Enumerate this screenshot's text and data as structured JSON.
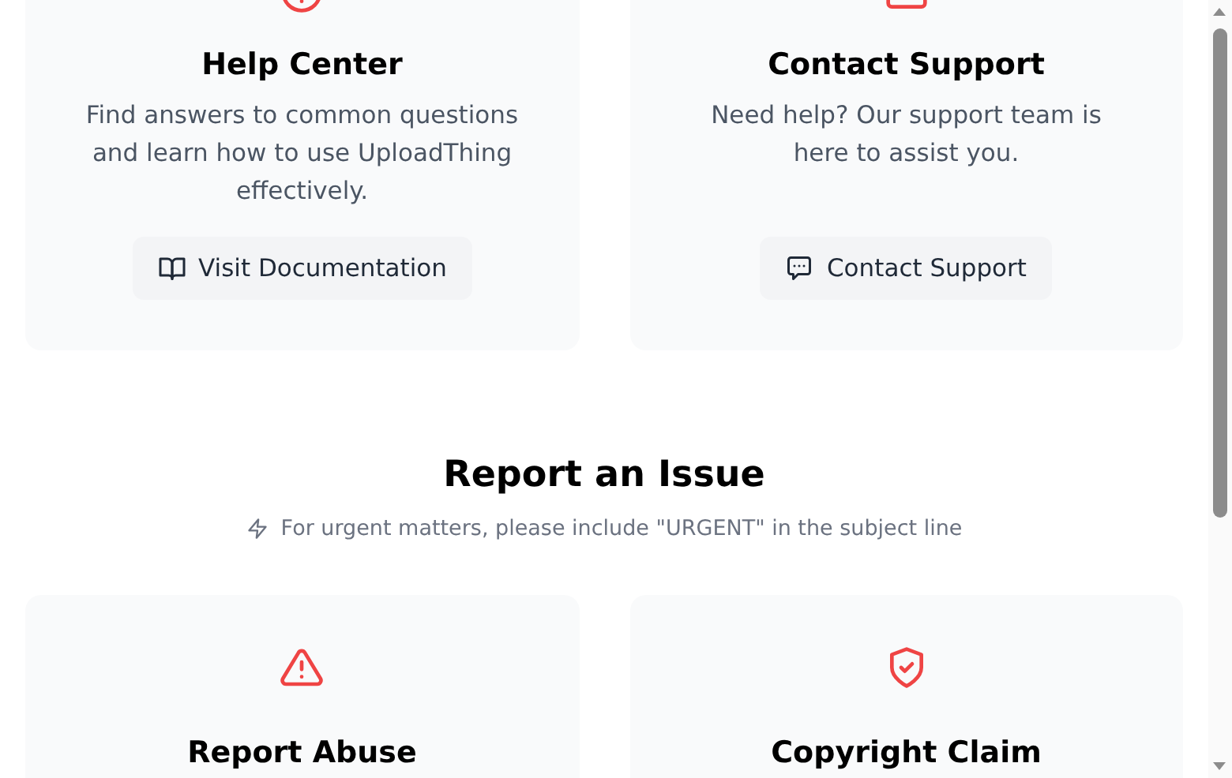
{
  "support_cards": [
    {
      "title": "Help Center",
      "description": "Find answers to common questions and learn how to use UploadThing effectively.",
      "button": "Visit Documentation"
    },
    {
      "title": "Contact Support",
      "description": "Need help? Our support team is here to assist you.",
      "button": "Contact Support"
    }
  ],
  "report_section": {
    "title": "Report an Issue",
    "note": "For urgent matters, please include \"URGENT\" in the subject line",
    "cards": [
      {
        "title": "Report Abuse"
      },
      {
        "title": "Copyright Claim"
      }
    ]
  }
}
